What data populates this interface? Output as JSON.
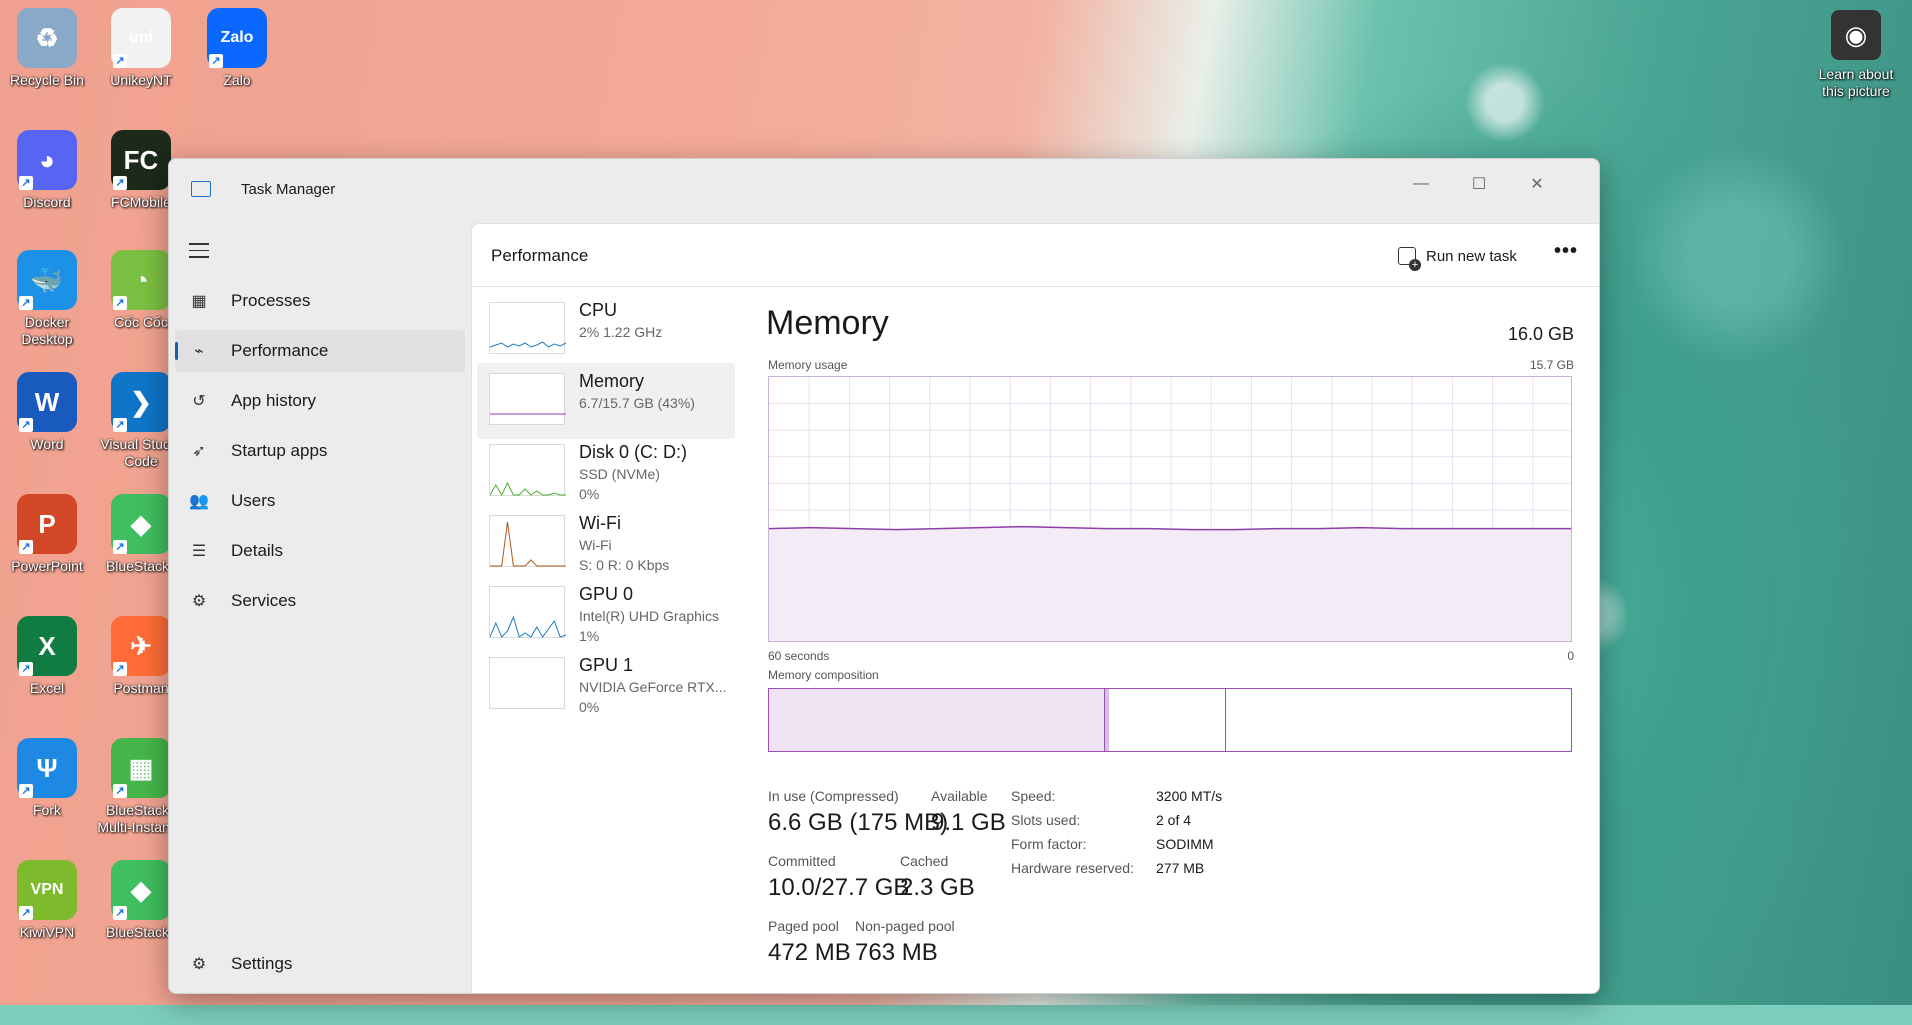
{
  "desktop": {
    "icons": [
      {
        "label": "Recycle Bin",
        "glyph": "♻",
        "color": "#8aa9c8"
      },
      {
        "label": "UnikeyNT",
        "glyph": "uni",
        "color": "#f2f2f2"
      },
      {
        "label": "Zalo",
        "glyph": "Zalo",
        "color": "#0a68ff"
      },
      {
        "label": "Discord",
        "glyph": "◕",
        "color": "#5865f2"
      },
      {
        "label": "FCMobile",
        "glyph": "FC",
        "color": "#1b2a1b"
      },
      {
        "label": "Docker Desktop",
        "glyph": "🐳",
        "color": "#1d91e6"
      },
      {
        "label": "Cốc Cốc",
        "glyph": "◔",
        "color": "#7bc043"
      },
      {
        "label": "Word",
        "glyph": "W",
        "color": "#185abd"
      },
      {
        "label": "Visual Studio Code",
        "glyph": "❯",
        "color": "#0e75c9"
      },
      {
        "label": "PowerPoint",
        "glyph": "P",
        "color": "#d24726"
      },
      {
        "label": "BlueStacks",
        "glyph": "◆",
        "color": "#3fbf5f"
      },
      {
        "label": "Excel",
        "glyph": "X",
        "color": "#107c41"
      },
      {
        "label": "Postman",
        "glyph": "✈",
        "color": "#ff6c37"
      },
      {
        "label": "Fork",
        "glyph": "Ψ",
        "color": "#1e88e5"
      },
      {
        "label": "BlueStacks Multi-Instance",
        "glyph": "▦",
        "color": "#45b649"
      },
      {
        "label": "KiwiVPN",
        "glyph": "VPN",
        "color": "#7dbb2c"
      },
      {
        "label": "BlueStacks",
        "glyph": "◆",
        "color": "#3fbf5f"
      }
    ],
    "learn_label": "Learn about this picture"
  },
  "window": {
    "title": "Task Manager",
    "minimize": "—",
    "maximize": "☐",
    "close": "✕"
  },
  "sidebar": {
    "items": [
      {
        "label": "Processes",
        "icon": "processes-icon",
        "glyph": "▦"
      },
      {
        "label": "Performance",
        "icon": "performance-icon",
        "glyph": "⌁"
      },
      {
        "label": "App history",
        "icon": "history-icon",
        "glyph": "↺"
      },
      {
        "label": "Startup apps",
        "icon": "startup-icon",
        "glyph": "➶"
      },
      {
        "label": "Users",
        "icon": "users-icon",
        "glyph": "👥"
      },
      {
        "label": "Details",
        "icon": "details-icon",
        "glyph": "☰"
      },
      {
        "label": "Services",
        "icon": "services-icon",
        "glyph": "⚙"
      }
    ],
    "settings": "Settings"
  },
  "header": {
    "title": "Performance",
    "run_new_task": "Run new task",
    "more": "•••"
  },
  "devices": [
    {
      "name": "CPU",
      "sub": "2%  1.22 GHz",
      "sub2": "",
      "color": "#1d7bbf"
    },
    {
      "name": "Memory",
      "sub": "6.7/15.7 GB (43%)",
      "sub2": "",
      "color": "#8e3ea8"
    },
    {
      "name": "Disk 0 (C: D:)",
      "sub": "SSD (NVMe)",
      "sub2": "0%",
      "color": "#4caf2b"
    },
    {
      "name": "Wi-Fi",
      "sub": "Wi-Fi",
      "sub2": "S: 0 R: 0 Kbps",
      "color": "#b0561e"
    },
    {
      "name": "GPU 0",
      "sub": "Intel(R) UHD Graphics",
      "sub2": "1%",
      "color": "#1d7bbf"
    },
    {
      "name": "GPU 1",
      "sub": "NVIDIA GeForce RTX...",
      "sub2": "0%",
      "color": "#1d7bbf"
    }
  ],
  "memory": {
    "title": "Memory",
    "total": "16.0 GB",
    "usage_label": "Memory usage",
    "usage_max": "15.7 GB",
    "time_left": "60 seconds",
    "time_right": "0",
    "composition_label": "Memory composition",
    "usage_fraction": 0.43,
    "composition": {
      "in_use": 0.42,
      "modified": 0.005,
      "standby": 0.145
    },
    "in_use_label": "In use (Compressed)",
    "in_use_value": "6.6 GB (175 MB)",
    "available_label": "Available",
    "available_value": "9.1 GB",
    "committed_label": "Committed",
    "committed_value": "10.0/27.7 GB",
    "cached_label": "Cached",
    "cached_value": "2.3 GB",
    "paged_label": "Paged pool",
    "paged_value": "472 MB",
    "nonpaged_label": "Non-paged pool",
    "nonpaged_value": "763 MB",
    "speed_label": "Speed:",
    "speed_value": "3200 MT/s",
    "slots_label": "Slots used:",
    "slots_value": "2 of 4",
    "form_label": "Form factor:",
    "form_value": "SODIMM",
    "reserved_label": "Hardware reserved:",
    "reserved_value": "277 MB"
  },
  "colors": {
    "accent": "#1a5fb4",
    "memory": "#8e3ea8",
    "memory_fill": "#f2eaf6"
  }
}
